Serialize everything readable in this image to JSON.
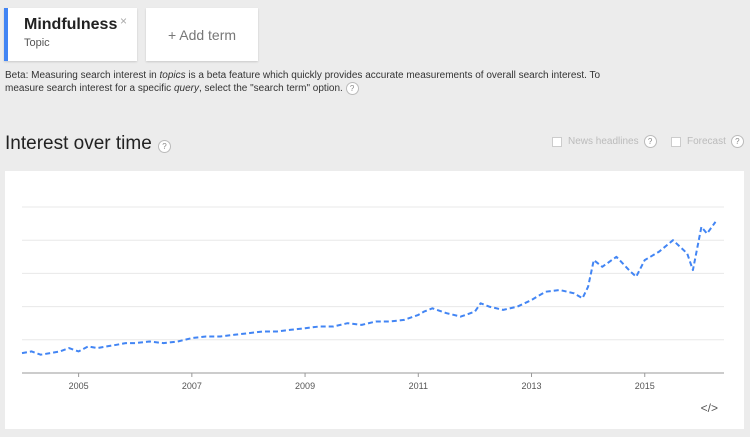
{
  "term": {
    "name": "Mindfulness",
    "type": "Topic",
    "close_glyph": "×"
  },
  "add_term_label": "+ Add term",
  "beta_note": {
    "prefix": "Beta: Measuring search interest in ",
    "em1": "topics",
    "middle": " is a beta feature which quickly provides accurate measurements of overall search interest. To measure search interest for a specific ",
    "em2": "query",
    "suffix": ", select the \"search term\" option."
  },
  "help_glyph": "?",
  "section_title": "Interest over time",
  "options": {
    "news_label": "News headlines",
    "forecast_label": "Forecast"
  },
  "embed_glyph": "</>",
  "colors": {
    "series": "#4285f4",
    "accent": "#4285f4"
  },
  "chart_data": {
    "type": "line",
    "title": "Interest over time",
    "xlabel": "",
    "ylabel": "",
    "grid": true,
    "x_ticks": [
      "2005",
      "2007",
      "2009",
      "2011",
      "2013",
      "2015"
    ],
    "xlim": [
      2004.0,
      2016.4
    ],
    "ylim": [
      0,
      100
    ],
    "series": [
      {
        "style": "dashed",
        "x": [
          2004.0,
          2004.17,
          2004.33,
          2004.5,
          2004.67,
          2004.83,
          2005.0,
          2005.17,
          2005.33,
          2005.5,
          2005.67,
          2005.83,
          2006.0,
          2006.25,
          2006.5,
          2006.75,
          2007.0,
          2007.25,
          2007.5,
          2007.75,
          2008.0,
          2008.25,
          2008.5,
          2008.75,
          2009.0,
          2009.25,
          2009.5,
          2009.75,
          2010.0,
          2010.25,
          2010.5,
          2010.75,
          2011.0,
          2011.1,
          2011.25,
          2011.5,
          2011.75,
          2012.0,
          2012.1,
          2012.25,
          2012.5,
          2012.75,
          2013.0,
          2013.1,
          2013.25,
          2013.5,
          2013.75,
          2013.9,
          2014.0,
          2014.1,
          2014.25,
          2014.5,
          2014.75,
          2014.85,
          2015.0,
          2015.25,
          2015.5,
          2015.75,
          2015.85,
          2016.0,
          2016.1,
          2016.25
        ],
        "y": [
          12,
          13,
          11,
          12,
          13,
          15,
          13,
          16,
          15,
          16,
          17,
          18,
          18,
          19,
          18,
          19,
          21,
          22,
          22,
          23,
          24,
          25,
          25,
          26,
          27,
          28,
          28,
          30,
          29,
          31,
          31,
          32,
          35,
          37,
          39,
          36,
          34,
          37,
          42,
          40,
          38,
          40,
          44,
          46,
          49,
          50,
          48,
          45,
          52,
          68,
          64,
          70,
          61,
          58,
          68,
          73,
          80,
          72,
          62,
          88,
          84,
          91
        ]
      }
    ]
  }
}
